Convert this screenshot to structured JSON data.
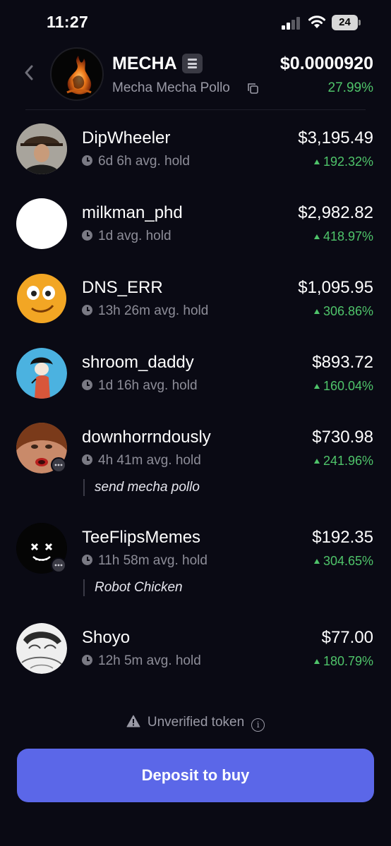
{
  "status_bar": {
    "time": "11:27",
    "battery": "24"
  },
  "token": {
    "symbol": "MECHA",
    "name": "Mecha Mecha Pollo",
    "price": "$0.0000920",
    "change": "27.99%",
    "chain_icon": "solana-icon"
  },
  "holders": [
    {
      "name": "DipWheeler",
      "hold": "6d 6h avg. hold",
      "value": "$3,195.49",
      "change": "192.32%",
      "comment": ""
    },
    {
      "name": "milkman_phd",
      "hold": "1d avg. hold",
      "value": "$2,982.82",
      "change": "418.97%",
      "comment": ""
    },
    {
      "name": "DNS_ERR",
      "hold": "13h 26m avg. hold",
      "value": "$1,095.95",
      "change": "306.86%",
      "comment": ""
    },
    {
      "name": "shroom_daddy",
      "hold": "1d 16h avg. hold",
      "value": "$893.72",
      "change": "160.04%",
      "comment": ""
    },
    {
      "name": "downhorrndously",
      "hold": "4h 41m avg. hold",
      "value": "$730.98",
      "change": "241.96%",
      "comment": "send mecha pollo"
    },
    {
      "name": "TeeFlipsMemes",
      "hold": "11h 58m avg. hold",
      "value": "$192.35",
      "change": "304.65%",
      "comment": "Robot Chicken"
    },
    {
      "name": "Shoyo",
      "hold": "12h 5m avg. hold",
      "value": "$77.00",
      "change": "180.79%",
      "comment": ""
    }
  ],
  "footer": {
    "unverified_label": "Unverified token",
    "deposit_label": "Deposit to buy"
  },
  "colors": {
    "background": "#0a0a14",
    "positive": "#4fc46a",
    "button": "#5b67e8",
    "muted": "#8d8d98"
  }
}
